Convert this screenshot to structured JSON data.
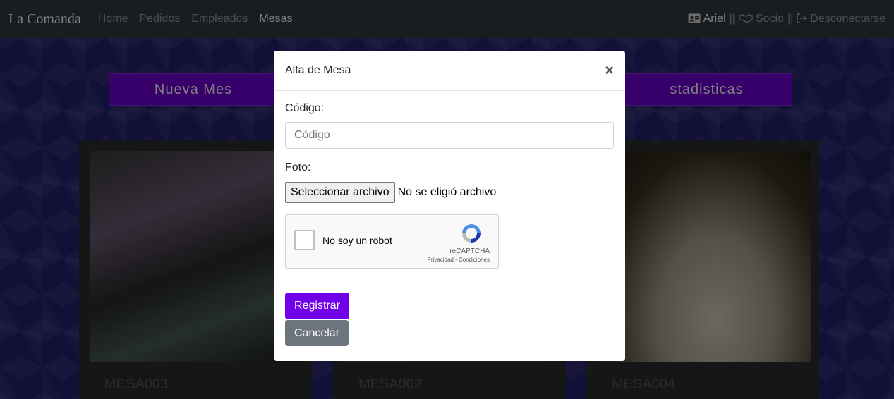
{
  "navbar": {
    "brand": "La Comanda",
    "links": [
      "Home",
      "Pedidos",
      "Empleados",
      "Mesas"
    ],
    "active": "Mesas",
    "user": "Ariel",
    "role": "Socio",
    "logout": "Desconectarse",
    "separator": "||"
  },
  "header_buttons": {
    "new_label": "Nueva Mes",
    "stats_label": "stadisticas"
  },
  "cards": [
    {
      "title": "MESA003"
    },
    {
      "title": "MESA002"
    },
    {
      "title": "MESA004"
    }
  ],
  "modal": {
    "title": "Alta de Mesa",
    "close": "×",
    "codigo_label": "Código:",
    "codigo_placeholder": "Código",
    "foto_label": "Foto:",
    "file_button": "Seleccionar archivo",
    "file_status": "No se eligió archivo",
    "captcha_text": "No soy un robot",
    "captcha_brand": "reCAPTCHA",
    "captcha_links": "Privacidad - Condiciones",
    "submit": "Registrar",
    "cancel": "Cancelar"
  },
  "colors": {
    "primary": "#7000e8",
    "secondary": "#6c757d",
    "navbar": "#343a40"
  }
}
